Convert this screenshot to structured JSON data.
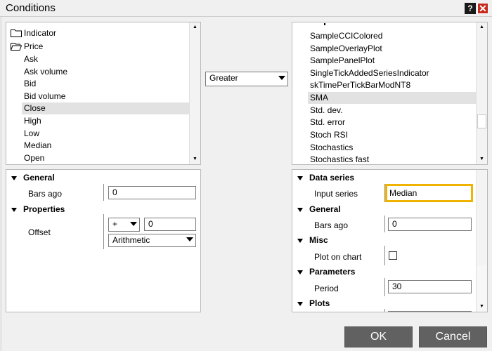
{
  "window": {
    "title": "Conditions",
    "help_label": "?",
    "close_label": "✕"
  },
  "left_tree": {
    "items": [
      {
        "label": "Indicator",
        "type": "folder"
      },
      {
        "label": "Price",
        "type": "folder-open"
      },
      {
        "label": "Ask"
      },
      {
        "label": "Ask volume"
      },
      {
        "label": "Bid"
      },
      {
        "label": "Bid volume"
      },
      {
        "label": "Close",
        "selected": true
      },
      {
        "label": "High"
      },
      {
        "label": "Low"
      },
      {
        "label": "Median"
      },
      {
        "label": "Open"
      }
    ]
  },
  "operator": {
    "selected": "Greater"
  },
  "right_list": {
    "items": [
      {
        "label": "SampleCCIColored"
      },
      {
        "label": "SampleOverlayPlot"
      },
      {
        "label": "SamplePanelPlot"
      },
      {
        "label": "SingleTickAddedSeriesIndicator"
      },
      {
        "label": "skTimePerTickBarModNT8"
      },
      {
        "label": "SMA",
        "selected": true
      },
      {
        "label": "Std. dev."
      },
      {
        "label": "Std. error"
      },
      {
        "label": "Stoch RSI"
      },
      {
        "label": "Stochastics"
      },
      {
        "label": "Stochastics fast"
      }
    ]
  },
  "left_props": {
    "general": {
      "label": "General",
      "bars_ago_label": "Bars ago",
      "bars_ago_value": "0"
    },
    "properties": {
      "label": "Properties",
      "offset_label": "Offset",
      "offset_operator": "+",
      "offset_value": "0",
      "offset_type": "Arithmetic"
    }
  },
  "right_props": {
    "data_series": {
      "label": "Data series",
      "input_series_label": "Input series",
      "input_series_value": "Median"
    },
    "general": {
      "label": "General",
      "bars_ago_label": "Bars ago",
      "bars_ago_value": "0"
    },
    "misc": {
      "label": "Misc",
      "plot_on_chart_label": "Plot on chart",
      "plot_on_chart_checked": false
    },
    "parameters": {
      "label": "Parameters",
      "period_label": "Period",
      "period_value": "30"
    },
    "plots": {
      "label": "Plots"
    }
  },
  "buttons": {
    "ok": "OK",
    "cancel": "Cancel"
  },
  "colors": {
    "highlight_border": "#f0b400",
    "button_bg": "#616161",
    "close_bg": "#c42b1c",
    "selection_bg": "#e2e2e2"
  }
}
